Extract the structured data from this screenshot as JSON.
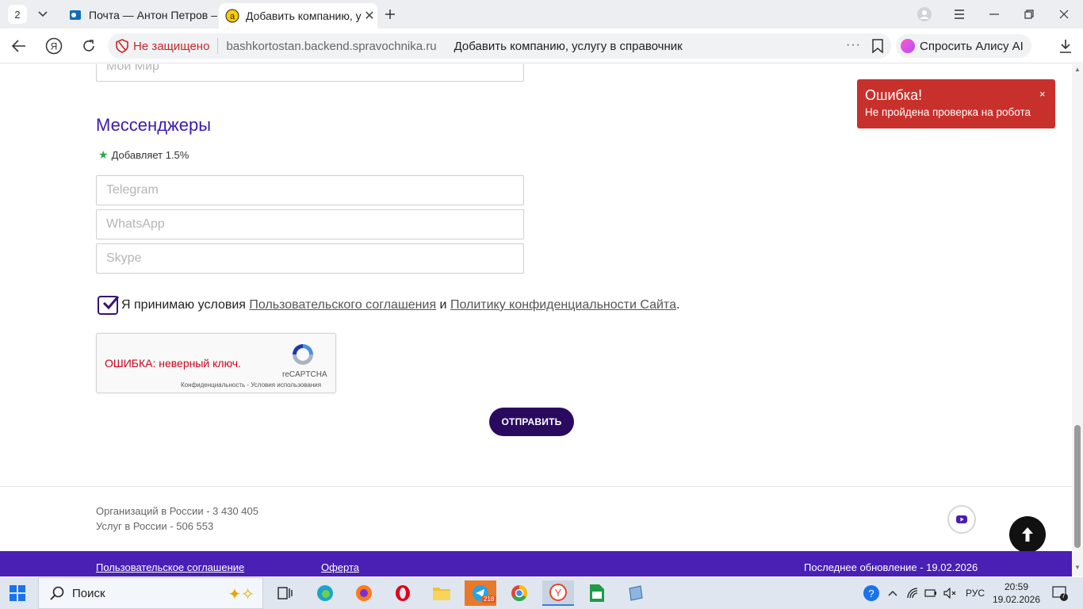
{
  "browser": {
    "tab_count": "2",
    "tabs": [
      {
        "title": "Почта — Антон Петров — Яндекс Почта"
      },
      {
        "title": "Добавить компанию, услугу в справочник"
      }
    ],
    "security_label": "Не защищено",
    "domain": "bashkortostan.backend.spravochnika.ru",
    "page_title": "Добавить компанию, услугу в справочник",
    "more_glyph": "···",
    "alice_label": "Спросить Алису AI"
  },
  "form": {
    "moimir_placeholder": "Мой Мир",
    "messengers_title": "Мессенджеры",
    "bonus": "Добавляет 1.5%",
    "telegram_placeholder": "Telegram",
    "whatsapp_placeholder": "WhatsApp",
    "skype_placeholder": "Skype",
    "agree_prefix": "Я принимаю условия ",
    "agree_link1": "Пользовательского соглашения",
    "agree_and": " и ",
    "agree_link2": "Политику конфиденциальности Сайта",
    "agree_suffix": ".",
    "agree_checked": true,
    "captcha_error": "ОШИБКА: неверный ключ.",
    "captcha_brand": "reCAPTCHA",
    "captcha_links": "Конфиденциальность - Условия использования",
    "submit_label": "ОТПРАВИТЬ"
  },
  "stats": {
    "orgs": "Организаций в России - 3 430 405",
    "services": "Услуг в России - 506 553"
  },
  "footer": {
    "link1": "Пользовательское соглашение",
    "link2": "Оферта",
    "updated": "Последнее обновление - 19.02.2026"
  },
  "toast": {
    "title": "Ошибка!",
    "message": "Не пройдена проверка на робота",
    "close": "×"
  },
  "taskbar": {
    "search_label": "Поиск",
    "telegram_badge": "218",
    "lang": "РУС",
    "time": "20:59",
    "date": "19.02.2026",
    "notifications": "7"
  },
  "colors": {
    "accent": "#4a1fb3",
    "title": "#3a1bb0",
    "submit": "#2a0a5e",
    "toast": "#c8302c",
    "error": "#d0021b"
  }
}
